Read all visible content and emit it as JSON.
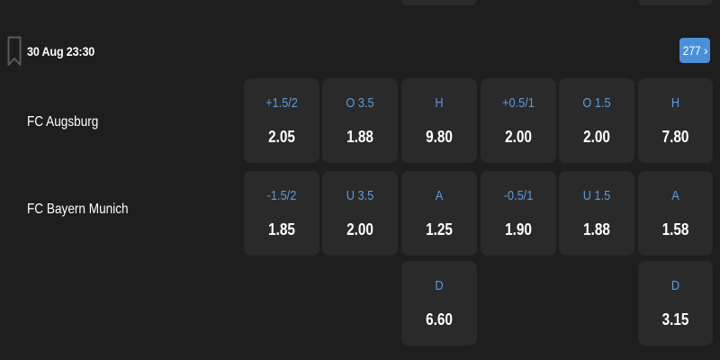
{
  "match": {
    "datetime": "30 Aug  23:30",
    "more_count": "277",
    "home_team": "FC Augsburg",
    "away_team": "FC Bayern Munich"
  },
  "odds": {
    "home": [
      {
        "label": "+1.5/2",
        "odd": "2.05"
      },
      {
        "label": "O 3.5",
        "odd": "1.88"
      },
      {
        "label": "H",
        "odd": "9.80"
      },
      {
        "label": "+0.5/1",
        "odd": "2.00"
      },
      {
        "label": "O 1.5",
        "odd": "2.00"
      },
      {
        "label": "H",
        "odd": "7.80"
      }
    ],
    "away": [
      {
        "label": "-1.5/2",
        "odd": "1.85"
      },
      {
        "label": "U 3.5",
        "odd": "2.00"
      },
      {
        "label": "A",
        "odd": "1.25"
      },
      {
        "label": "-0.5/1",
        "odd": "1.90"
      },
      {
        "label": "U 1.5",
        "odd": "1.88"
      },
      {
        "label": "A",
        "odd": "1.58"
      }
    ],
    "draw": [
      {
        "label": "D",
        "odd": "6.60"
      },
      {
        "label": "D",
        "odd": "3.15"
      }
    ]
  },
  "icons": {
    "bookmark": "bookmark-icon",
    "chevron": "chevron-right-icon"
  },
  "colors": {
    "background": "#1e1e1e",
    "cell": "#2a2a2a",
    "label": "#5b9bd8",
    "badge": "#4a90d9"
  }
}
